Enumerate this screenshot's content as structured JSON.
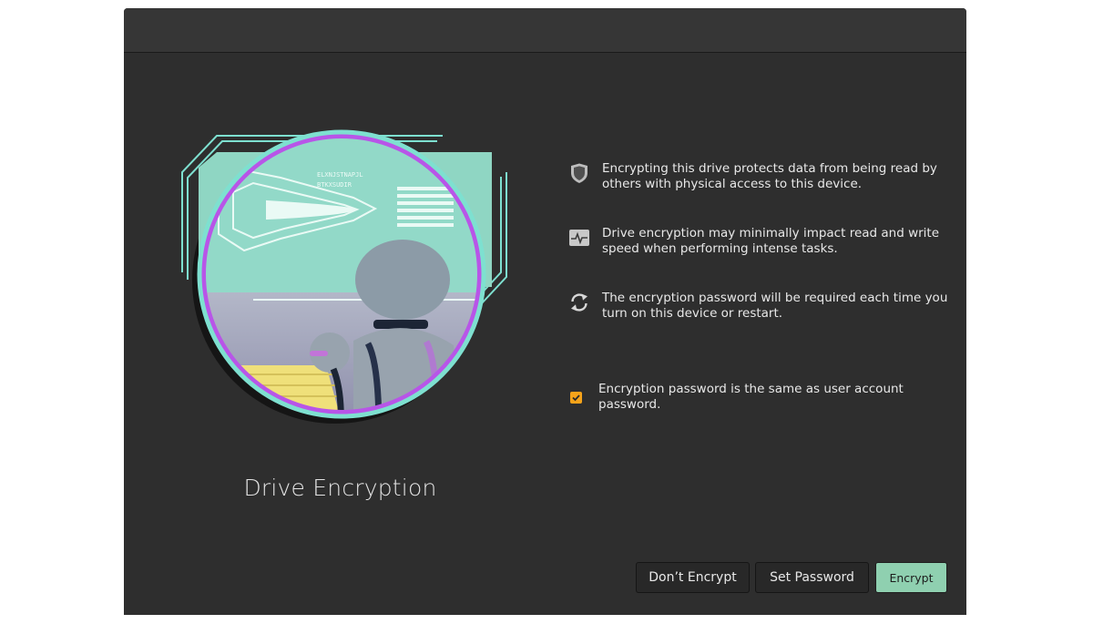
{
  "hero": {
    "title": "Drive Encryption"
  },
  "info": [
    {
      "icon": "shield-icon",
      "text": "Encrypting this drive protects data from being read by others with physical access to this device."
    },
    {
      "icon": "activity-monitor-icon",
      "text": "Drive encryption may minimally impact read and write speed when performing intense tasks."
    },
    {
      "icon": "restart-icon",
      "text": "The encryption password will be required each time you turn on this device or restart."
    }
  ],
  "checkbox": {
    "checked": true,
    "label": "Encryption password is the same as user account password."
  },
  "buttons": {
    "dont_encrypt": "Don’t Encrypt",
    "set_password": "Set Password",
    "encrypt": "Encrypt"
  },
  "illustration": {
    "screen_text_1": "ELXNJSTNAPJL",
    "screen_text_2": "BTKXSUDIR"
  },
  "colors": {
    "window_bg": "#2e2e2e",
    "titlebar_bg": "#363636",
    "accent_green": "#8fd0b0",
    "checkbox_orange": "#f5a31a",
    "ring_cyan": "#7ee0d0",
    "ring_purple": "#b855e8"
  }
}
